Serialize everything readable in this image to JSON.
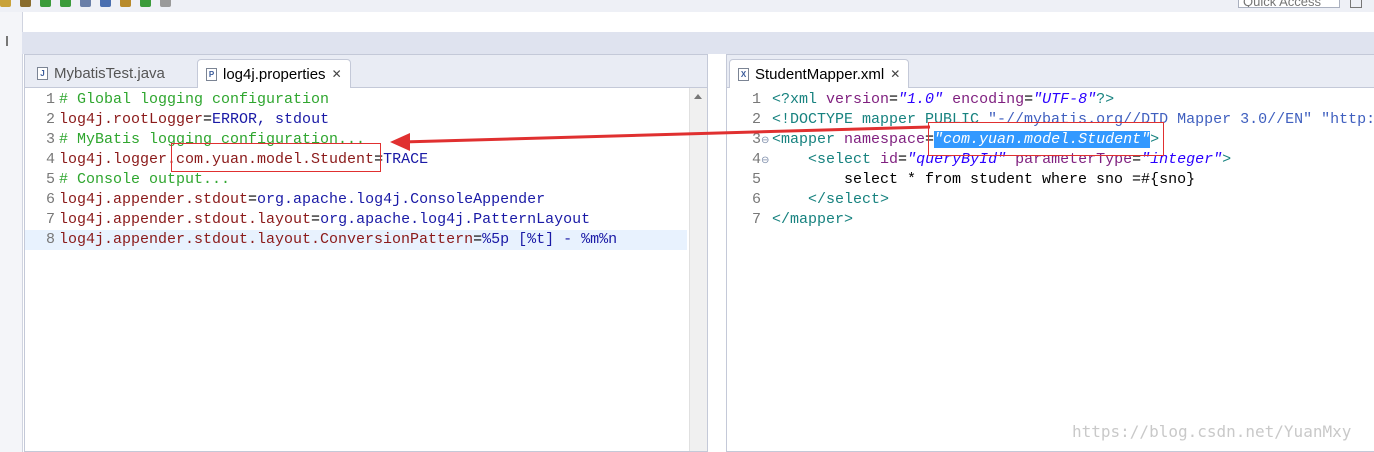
{
  "toolbar": {
    "quick_access_placeholder": "Quick Access",
    "icons": [
      "save-icon",
      "settings-icon",
      "build-icon",
      "run-icon",
      "debug-icon",
      "new-icon",
      "search-icon",
      "refresh-icon",
      "nav-icon"
    ]
  },
  "left_editor": {
    "tabs": [
      {
        "label": "MybatisTest.java",
        "icon": "java-file-icon",
        "active": false
      },
      {
        "label": "log4j.properties",
        "icon": "properties-file-icon",
        "active": true,
        "close": "✕"
      }
    ],
    "lines": [
      {
        "n": "1",
        "parts": [
          {
            "cls": "cm",
            "t": "# Global logging configuration"
          }
        ]
      },
      {
        "n": "2",
        "parts": [
          {
            "cls": "key",
            "t": "log4j.rootLogger"
          },
          {
            "cls": "txt",
            "t": "="
          },
          {
            "cls": "val",
            "t": "ERROR, stdout"
          }
        ]
      },
      {
        "n": "3",
        "parts": [
          {
            "cls": "cm",
            "t": "# MyBatis logging configuration..."
          }
        ]
      },
      {
        "n": "4",
        "parts": [
          {
            "cls": "key",
            "t": "log4j.logger.com.yuan.model.Student"
          },
          {
            "cls": "txt",
            "t": "="
          },
          {
            "cls": "val",
            "t": "TRACE"
          }
        ]
      },
      {
        "n": "5",
        "parts": [
          {
            "cls": "cm",
            "t": "# Console output..."
          }
        ]
      },
      {
        "n": "6",
        "parts": [
          {
            "cls": "key",
            "t": "log4j.appender.stdout"
          },
          {
            "cls": "txt",
            "t": "="
          },
          {
            "cls": "val",
            "t": "org.apache.log4j.ConsoleAppender"
          }
        ]
      },
      {
        "n": "7",
        "parts": [
          {
            "cls": "key",
            "t": "log4j.appender.stdout.layout"
          },
          {
            "cls": "txt",
            "t": "="
          },
          {
            "cls": "val",
            "t": "org.apache.log4j.PatternLayout"
          }
        ]
      },
      {
        "n": "8",
        "parts": [
          {
            "cls": "key",
            "t": "log4j.appender.stdout.layout.ConversionPattern"
          },
          {
            "cls": "txt",
            "t": "="
          },
          {
            "cls": "val",
            "t": "%5p [%t] - %m%n"
          }
        ]
      }
    ],
    "current_line": 8
  },
  "right_editor": {
    "tabs": [
      {
        "label": "StudentMapper.xml",
        "icon": "xml-file-icon",
        "active": true,
        "close": "✕"
      }
    ],
    "lines": [
      {
        "n": "1",
        "fold": "",
        "parts": [
          {
            "cls": "xt",
            "t": "<?xml "
          },
          {
            "cls": "xa",
            "t": "version"
          },
          {
            "cls": "txt",
            "t": "="
          },
          {
            "cls": "xs",
            "t": "\"1.0\""
          },
          {
            "cls": "txt",
            "t": " "
          },
          {
            "cls": "xa",
            "t": "encoding"
          },
          {
            "cls": "txt",
            "t": "="
          },
          {
            "cls": "xs",
            "t": "\"UTF-8\""
          },
          {
            "cls": "xt",
            "t": "?>"
          }
        ]
      },
      {
        "n": "2",
        "fold": "",
        "parts": [
          {
            "cls": "xt",
            "t": "<!DOCTYPE mapper PUBLIC "
          },
          {
            "cls": "xd",
            "t": "\"-//mybatis.org//DTD Mapper 3.0//EN\""
          },
          {
            "cls": "txt",
            "t": " "
          },
          {
            "cls": "xd",
            "t": "\"http:"
          }
        ]
      },
      {
        "n": "3",
        "fold": "⊖",
        "parts": [
          {
            "cls": "xt",
            "t": "<mapper "
          },
          {
            "cls": "xa",
            "t": "namespace"
          },
          {
            "cls": "txt",
            "t": "="
          },
          {
            "cls": "xs",
            "t": "\"com.yuan.model.Student\""
          },
          {
            "cls": "xt",
            "t": ">"
          }
        ]
      },
      {
        "n": "4",
        "fold": "⊖",
        "parts": [
          {
            "cls": "txt",
            "t": "    "
          },
          {
            "cls": "xt",
            "t": "<select "
          },
          {
            "cls": "xa",
            "t": "id"
          },
          {
            "cls": "txt",
            "t": "="
          },
          {
            "cls": "xs",
            "t": "\"queryById\""
          },
          {
            "cls": "txt",
            "t": " "
          },
          {
            "cls": "xa",
            "t": "parameterType"
          },
          {
            "cls": "txt",
            "t": "="
          },
          {
            "cls": "xs",
            "t": "\"integer\""
          },
          {
            "cls": "xt",
            "t": ">"
          }
        ]
      },
      {
        "n": "5",
        "fold": "",
        "parts": [
          {
            "cls": "txt",
            "t": "        select * from student where sno =#{sno}"
          }
        ]
      },
      {
        "n": "6",
        "fold": "",
        "parts": [
          {
            "cls": "txt",
            "t": "    "
          },
          {
            "cls": "xt",
            "t": "</select>"
          }
        ]
      },
      {
        "n": "7",
        "fold": "",
        "parts": [
          {
            "cls": "xt",
            "t": "</mapper>"
          }
        ]
      }
    ]
  },
  "watermark": "https://blog.csdn.net/YuanMxy",
  "colors": {
    "annotation": "#e03030",
    "selection": "#3399ff",
    "current_line": "#e8f2fe"
  }
}
